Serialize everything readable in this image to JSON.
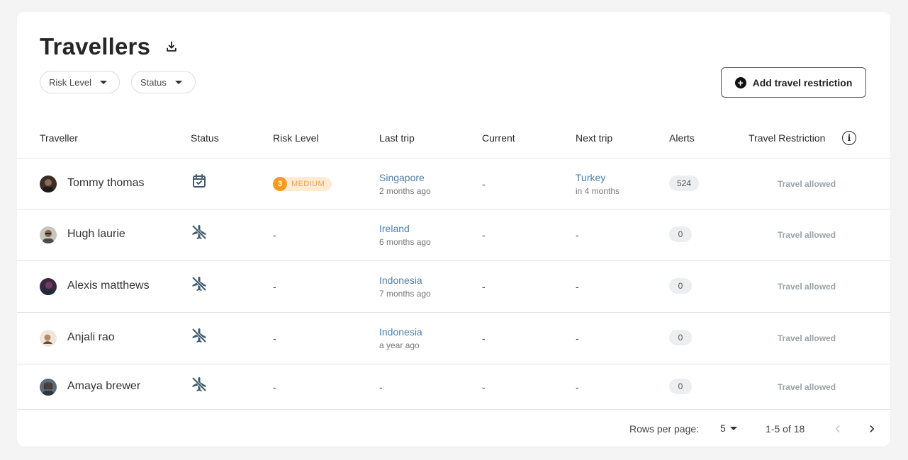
{
  "header": {
    "title": "Travellers"
  },
  "filters": {
    "risk_level": "Risk Level",
    "status": "Status"
  },
  "actions": {
    "add_restriction": "Add travel restriction"
  },
  "columns": [
    "Traveller",
    "Status",
    "Risk Level",
    "Last trip",
    "Current",
    "Next trip",
    "Alerts",
    "Travel Restriction"
  ],
  "rows": [
    {
      "name": "Tommy thomas",
      "status_icon": "calendar-check-icon",
      "risk_num": "3",
      "risk_label": "MEDIUM",
      "last_place": "Singapore",
      "last_ago": "2 months ago",
      "current": "-",
      "next_place": "Turkey",
      "next_in": "in 4 months",
      "alerts": "524",
      "restriction": "Travel allowed"
    },
    {
      "name": "Hugh laurie",
      "status_icon": "flight-off-icon",
      "risk": "-",
      "last_place": "Ireland",
      "last_ago": "6 months ago",
      "current": "-",
      "next": "-",
      "alerts": "0",
      "restriction": "Travel allowed"
    },
    {
      "name": "Alexis matthews",
      "status_icon": "flight-off-icon",
      "risk": "-",
      "last_place": "Indonesia",
      "last_ago": "7 months ago",
      "current": "-",
      "next": "-",
      "alerts": "0",
      "restriction": "Travel allowed"
    },
    {
      "name": "Anjali rao",
      "status_icon": "flight-off-icon",
      "risk": "-",
      "last_place": "Indonesia",
      "last_ago": "a year ago",
      "current": "-",
      "next": "-",
      "alerts": "0",
      "restriction": "Travel allowed"
    },
    {
      "name": "Amaya brewer",
      "status_icon": "flight-off-icon",
      "risk": "-",
      "last": "-",
      "current": "-",
      "next": "-",
      "alerts": "0",
      "restriction": "Travel allowed"
    }
  ],
  "pagination": {
    "rows_per_page_label": "Rows per page:",
    "rows_per_page": "5",
    "range": "1-5 of 18"
  },
  "colors": {
    "accent_link": "#4d7fa8",
    "risk_medium": "#f59a1f",
    "icon_slate": "#3f5a6e"
  }
}
